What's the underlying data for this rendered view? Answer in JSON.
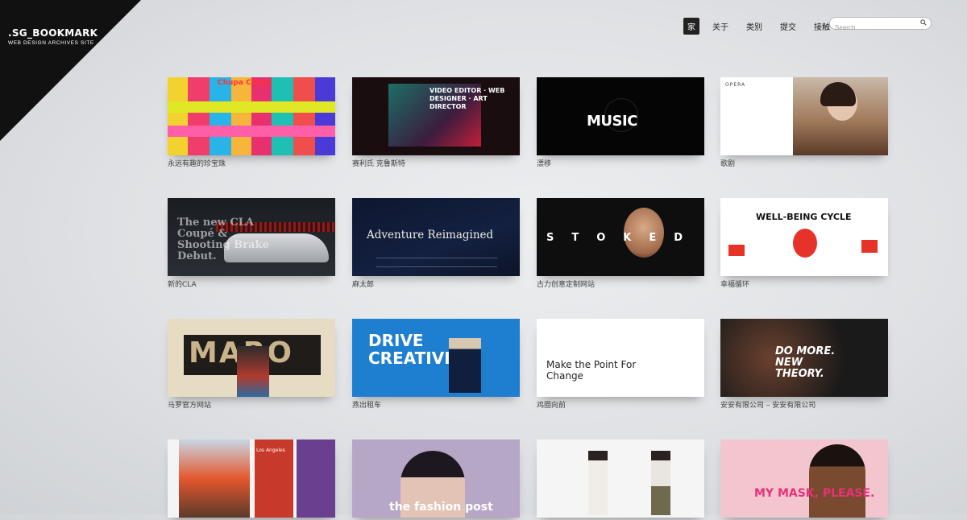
{
  "logo": {
    "title": ".SG_BOOKMARK",
    "subtitle": "WEB DESIGN ARCHIVES SITE"
  },
  "nav": {
    "items": [
      "家",
      "关于",
      "类别",
      "提交",
      "接触"
    ],
    "active": "家"
  },
  "search": {
    "placeholder": "Search"
  },
  "cards": [
    {
      "caption": "永远有趣的珍宝珠",
      "thumb_text": "Chupa Chups"
    },
    {
      "caption": "赛利氏 克鲁斯特",
      "thumb_text": "VIDEO EDITOR · WEB DESIGNER · ART DIRECTOR"
    },
    {
      "caption": "漂移",
      "thumb_text": "MUSIC"
    },
    {
      "caption": "歌剧",
      "thumb_text": "OPERA"
    },
    {
      "caption": "新的CLA",
      "thumb_text": "The new CLA Coupé & Shooting Brake Debut."
    },
    {
      "caption": "麻太郎",
      "thumb_text": "Adventure Reimagined"
    },
    {
      "caption": "古力创意定制网站",
      "thumb_text": "STOKED"
    },
    {
      "caption": "幸福循环",
      "thumb_text": "WELL-BEING CYCLE"
    },
    {
      "caption": "马罗官方网站",
      "thumb_text": "MARO"
    },
    {
      "caption": "燕出租车",
      "thumb_text": "DRIVE CREATIVITY"
    },
    {
      "caption": "鸡圈向前",
      "thumb_text": "Make the Point For Change"
    },
    {
      "caption": "安安有限公司 – 安安有限公司",
      "thumb_text": "DO MORE. NEW THEORY."
    },
    {
      "caption": "",
      "thumb_text": "Los Angeles"
    },
    {
      "caption": "",
      "thumb_text": "the fashion post"
    },
    {
      "caption": "",
      "thumb_text": ""
    },
    {
      "caption": "",
      "thumb_text": "MY MASK, PLEASE."
    }
  ]
}
